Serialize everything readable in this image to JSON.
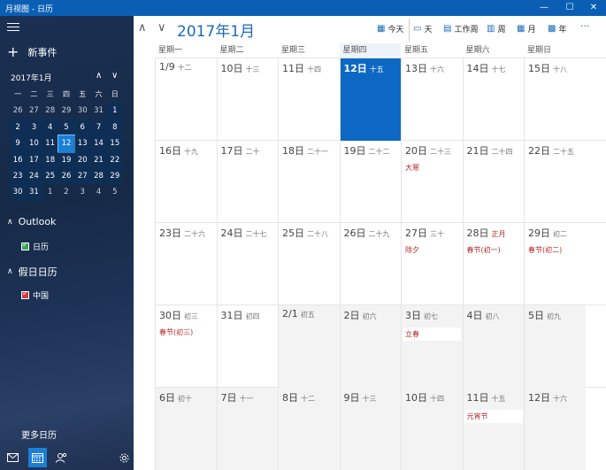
{
  "window": {
    "title": "月视图 - 日历",
    "min": "—",
    "max": "☐",
    "close": "✕"
  },
  "sidebar": {
    "new_event": "新事件",
    "mini_month": "2017年1月",
    "weekdays": [
      "一",
      "二",
      "三",
      "四",
      "五",
      "六",
      "日"
    ],
    "weeks": [
      [
        [
          "26",
          0
        ],
        [
          "27",
          0
        ],
        [
          "28",
          0
        ],
        [
          "29",
          0
        ],
        [
          "30",
          0
        ],
        [
          "31",
          0
        ],
        [
          "1",
          1
        ]
      ],
      [
        [
          "2",
          1
        ],
        [
          "3",
          1
        ],
        [
          "4",
          1
        ],
        [
          "5",
          1
        ],
        [
          "6",
          1
        ],
        [
          "7",
          1
        ],
        [
          "8",
          1
        ]
      ],
      [
        [
          "9",
          1
        ],
        [
          "10",
          1
        ],
        [
          "11",
          1
        ],
        [
          "12",
          2
        ],
        [
          "13",
          1
        ],
        [
          "14",
          1
        ],
        [
          "15",
          1
        ]
      ],
      [
        [
          "16",
          1
        ],
        [
          "17",
          1
        ],
        [
          "18",
          1
        ],
        [
          "19",
          1
        ],
        [
          "20",
          1
        ],
        [
          "21",
          1
        ],
        [
          "22",
          1
        ]
      ],
      [
        [
          "23",
          1
        ],
        [
          "24",
          1
        ],
        [
          "25",
          1
        ],
        [
          "26",
          1
        ],
        [
          "27",
          1
        ],
        [
          "28",
          1
        ],
        [
          "29",
          1
        ]
      ],
      [
        [
          "30",
          1
        ],
        [
          "31",
          1
        ],
        [
          "1",
          0
        ],
        [
          "2",
          0
        ],
        [
          "3",
          0
        ],
        [
          "4",
          0
        ],
        [
          "5",
          0
        ]
      ]
    ],
    "sections": [
      {
        "name": "Outlook",
        "item": "日历",
        "color": "green"
      },
      {
        "name": "假日日历",
        "item": "中国",
        "color": "red"
      }
    ],
    "more_calendars": "更多日历"
  },
  "main": {
    "title": "2017年1月",
    "toolbar": {
      "today": "今天",
      "day": "天",
      "workweek": "工作周",
      "week": "周",
      "month": "月",
      "year": "年",
      "more": "···"
    },
    "day_headers": [
      "星期一",
      "星期二",
      "星期三",
      "星期四",
      "星期五",
      "星期六",
      "星期日"
    ],
    "weeks": [
      [
        {
          "day": "1/9",
          "lunar": "十二"
        },
        {
          "day": "10日",
          "lunar": "十三"
        },
        {
          "day": "11日",
          "lunar": "十四"
        },
        {
          "day": "12日",
          "lunar": "十五",
          "selected": true
        },
        {
          "day": "13日",
          "lunar": "十六"
        },
        {
          "day": "14日",
          "lunar": "十七"
        },
        {
          "day": "15日",
          "lunar": "十八"
        }
      ],
      [
        {
          "day": "16日",
          "lunar": "十九"
        },
        {
          "day": "17日",
          "lunar": "二十"
        },
        {
          "day": "18日",
          "lunar": "二十一"
        },
        {
          "day": "19日",
          "lunar": "二十二"
        },
        {
          "day": "20日",
          "lunar": "二十三",
          "event": "大寒"
        },
        {
          "day": "21日",
          "lunar": "二十四"
        },
        {
          "day": "22日",
          "lunar": "二十五"
        }
      ],
      [
        {
          "day": "23日",
          "lunar": "二十六"
        },
        {
          "day": "24日",
          "lunar": "二十七"
        },
        {
          "day": "25日",
          "lunar": "二十八"
        },
        {
          "day": "26日",
          "lunar": "二十九"
        },
        {
          "day": "27日",
          "lunar": "三十",
          "event": "除夕"
        },
        {
          "day": "28日",
          "lunar": "正月",
          "lunar_festive": true,
          "event": "春节(初一)"
        },
        {
          "day": "29日",
          "lunar": "初二",
          "event": "春节(初二)"
        }
      ],
      [
        {
          "day": "30日",
          "lunar": "初三",
          "event": "春节(初三)"
        },
        {
          "day": "31日",
          "lunar": "初四"
        },
        {
          "day": "2/1",
          "lunar": "初五",
          "gray": true
        },
        {
          "day": "2日",
          "lunar": "初六",
          "gray": true
        },
        {
          "day": "3日",
          "lunar": "初七",
          "gray": true,
          "event": "立春",
          "boxed": true
        },
        {
          "day": "4日",
          "lunar": "初八",
          "gray": true
        },
        {
          "day": "5日",
          "lunar": "初九",
          "gray": true
        }
      ],
      [
        {
          "day": "6日",
          "lunar": "初十",
          "gray": true
        },
        {
          "day": "7日",
          "lunar": "十一",
          "gray": true
        },
        {
          "day": "8日",
          "lunar": "十二",
          "gray": true
        },
        {
          "day": "9日",
          "lunar": "十三",
          "gray": true
        },
        {
          "day": "10日",
          "lunar": "十四",
          "gray": true
        },
        {
          "day": "11日",
          "lunar": "十五",
          "gray": true,
          "event": "元宵节",
          "boxed": true
        },
        {
          "day": "12日",
          "lunar": "十六",
          "gray": true
        }
      ]
    ]
  }
}
